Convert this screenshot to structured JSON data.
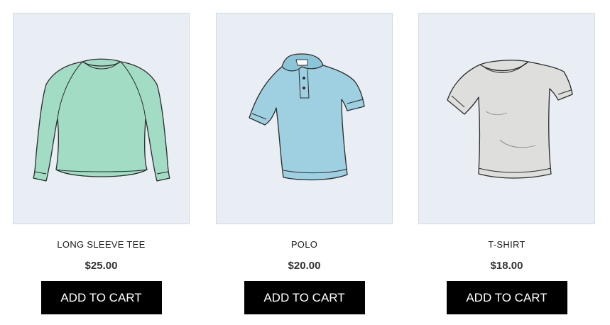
{
  "colors": {
    "thumbnail_bg": "#e8eef3",
    "button_bg": "#000000",
    "button_text": "#ffffff",
    "long_sleeve_fill": "#9fdcc4",
    "polo_fill": "#9fcfe0",
    "tshirt_fill": "#dededd"
  },
  "products": [
    {
      "name": "LONG SLEEVE TEE",
      "price": "$25.00",
      "button_label": "ADD TO CART",
      "icon": "long-sleeve-tee-icon"
    },
    {
      "name": "POLO",
      "price": "$20.00",
      "button_label": "ADD TO CART",
      "icon": "polo-shirt-icon"
    },
    {
      "name": "T-SHIRT",
      "price": "$18.00",
      "button_label": "ADD TO CART",
      "icon": "t-shirt-icon"
    }
  ]
}
